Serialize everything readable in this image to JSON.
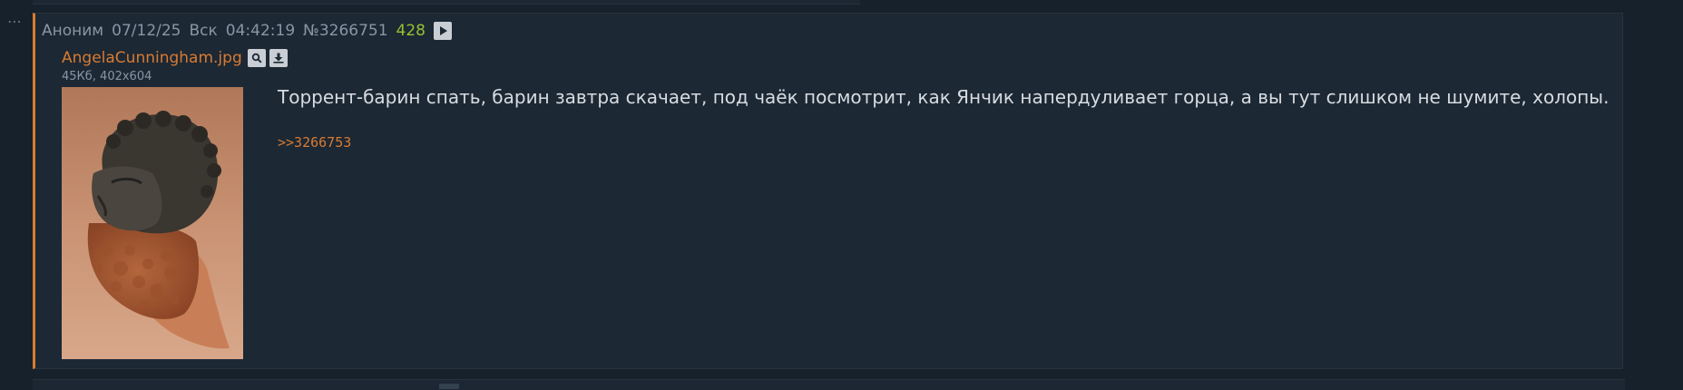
{
  "post": {
    "author": "Аноним",
    "date": "07/12/25",
    "weekday": "Вск",
    "time": "04:42:19",
    "number": "№3266751",
    "replies_count": "428",
    "file": {
      "name": "AngelaCunningham.jpg",
      "meta": "45Кб, 402x604"
    },
    "text": "Торрент-барин спать, барин завтра скачает, под чаёк посмотрит, как Янчик напердуливает горца, а вы тут слишком не шумите, холопы.",
    "reply_link": ">>3266753"
  },
  "colors": {
    "background": "#17212b",
    "post_background": "#1c2834",
    "accent": "#d87b32",
    "replies_count": "#96c033",
    "text": "#d7dce1",
    "muted": "#8a96a3"
  },
  "icons": {
    "menu": "ellipsis-icon",
    "play": "play-icon",
    "search": "magnifier-icon",
    "download": "download-icon"
  }
}
